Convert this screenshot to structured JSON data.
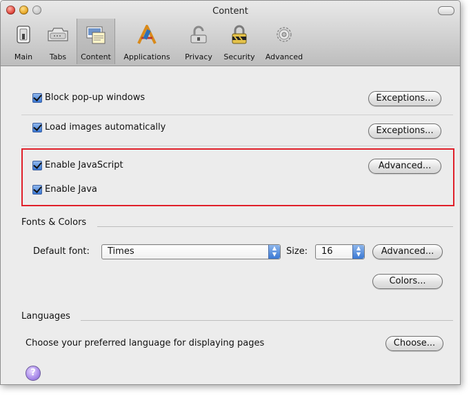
{
  "window": {
    "title": "Content"
  },
  "toolbar": {
    "items": [
      {
        "label": "Main",
        "icon": "switch-icon"
      },
      {
        "label": "Tabs",
        "icon": "tabs-icon"
      },
      {
        "label": "Content",
        "icon": "content-icon",
        "selected": true
      },
      {
        "label": "Applications",
        "icon": "applications-icon"
      },
      {
        "label": "Privacy",
        "icon": "privacy-icon"
      },
      {
        "label": "Security",
        "icon": "security-icon"
      },
      {
        "label": "Advanced",
        "icon": "gear-icon"
      }
    ]
  },
  "options": {
    "block_popups": {
      "label": "Block pop-up windows",
      "checked": true,
      "button": "Exceptions..."
    },
    "load_images": {
      "label": "Load images automatically",
      "checked": true,
      "button": "Exceptions..."
    },
    "enable_javascript": {
      "label": "Enable JavaScript",
      "checked": true,
      "button": "Advanced..."
    },
    "enable_java": {
      "label": "Enable Java",
      "checked": true
    }
  },
  "fonts_colors": {
    "heading": "Fonts & Colors",
    "default_font_label": "Default font:",
    "default_font_value": "Times",
    "size_label": "Size:",
    "size_value": "16",
    "advanced_button": "Advanced...",
    "colors_button": "Colors..."
  },
  "languages": {
    "heading": "Languages",
    "description": "Choose your preferred language for displaying pages",
    "choose_button": "Choose..."
  },
  "help": {
    "label": "?"
  },
  "colors": {
    "highlight_border": "#e0202a",
    "checkbox_blue": "#3a78d4"
  }
}
